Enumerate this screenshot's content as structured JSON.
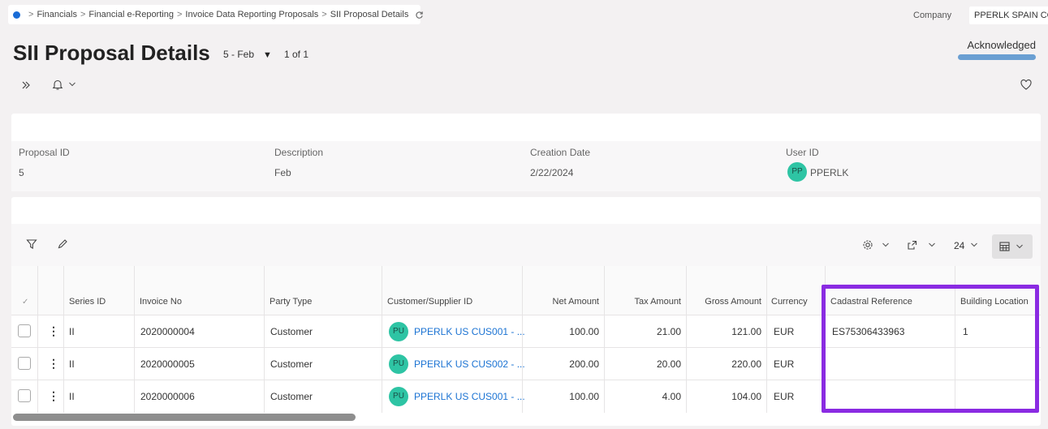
{
  "breadcrumb": {
    "items": [
      "Financials",
      "Financial e-Reporting",
      "Invoice Data Reporting Proposals",
      "SII Proposal Details"
    ],
    "separator": ">"
  },
  "company": {
    "label": "Company",
    "value": "PPERLK SPAIN COMPANY"
  },
  "page": {
    "title": "SII Proposal Details",
    "record": "5 - Feb",
    "pager": "1 of 1",
    "status": "Acknowledged"
  },
  "details": {
    "proposal_id_label": "Proposal ID",
    "proposal_id": "5",
    "description_label": "Description",
    "description": "Feb",
    "creation_date_label": "Creation Date",
    "creation_date": "2/22/2024",
    "user_id_label": "User ID",
    "user_initials": "PP",
    "user_id": "PPERLK"
  },
  "grid": {
    "page_size": "24",
    "columns": [
      "Series ID",
      "Invoice No",
      "Party Type",
      "Customer/Supplier ID",
      "Net Amount",
      "Tax Amount",
      "Gross Amount",
      "Currency",
      "Cadastral Reference",
      "Building Location"
    ],
    "rows": [
      {
        "series": "II",
        "invoice": "2020000004",
        "party": "Customer",
        "initials": "PU",
        "customer": "PPERLK US CUS001 - ...",
        "net": "100.00",
        "tax": "21.00",
        "gross": "121.00",
        "currency": "EUR",
        "cadastral": "ES75306433963",
        "building": "1"
      },
      {
        "series": "II",
        "invoice": "2020000005",
        "party": "Customer",
        "initials": "PU",
        "customer": "PPERLK US CUS002 - ...",
        "net": "200.00",
        "tax": "20.00",
        "gross": "220.00",
        "currency": "EUR",
        "cadastral": "",
        "building": ""
      },
      {
        "series": "II",
        "invoice": "2020000006",
        "party": "Customer",
        "initials": "PU",
        "customer": "PPERLK US CUS001 - ...",
        "net": "100.00",
        "tax": "4.00",
        "gross": "104.00",
        "currency": "EUR",
        "cadastral": "",
        "building": ""
      }
    ]
  },
  "colors": {
    "accent_link": "#1b73d3",
    "highlight": "#8a2be2",
    "avatar": "#2ec4a4",
    "status_bar": "#6a9fd2"
  },
  "icons": [
    "refresh-icon",
    "expand-icon",
    "bell-icon",
    "heart-icon",
    "filter-icon",
    "edit-icon",
    "settings-icon",
    "export-icon",
    "table-view-icon"
  ]
}
